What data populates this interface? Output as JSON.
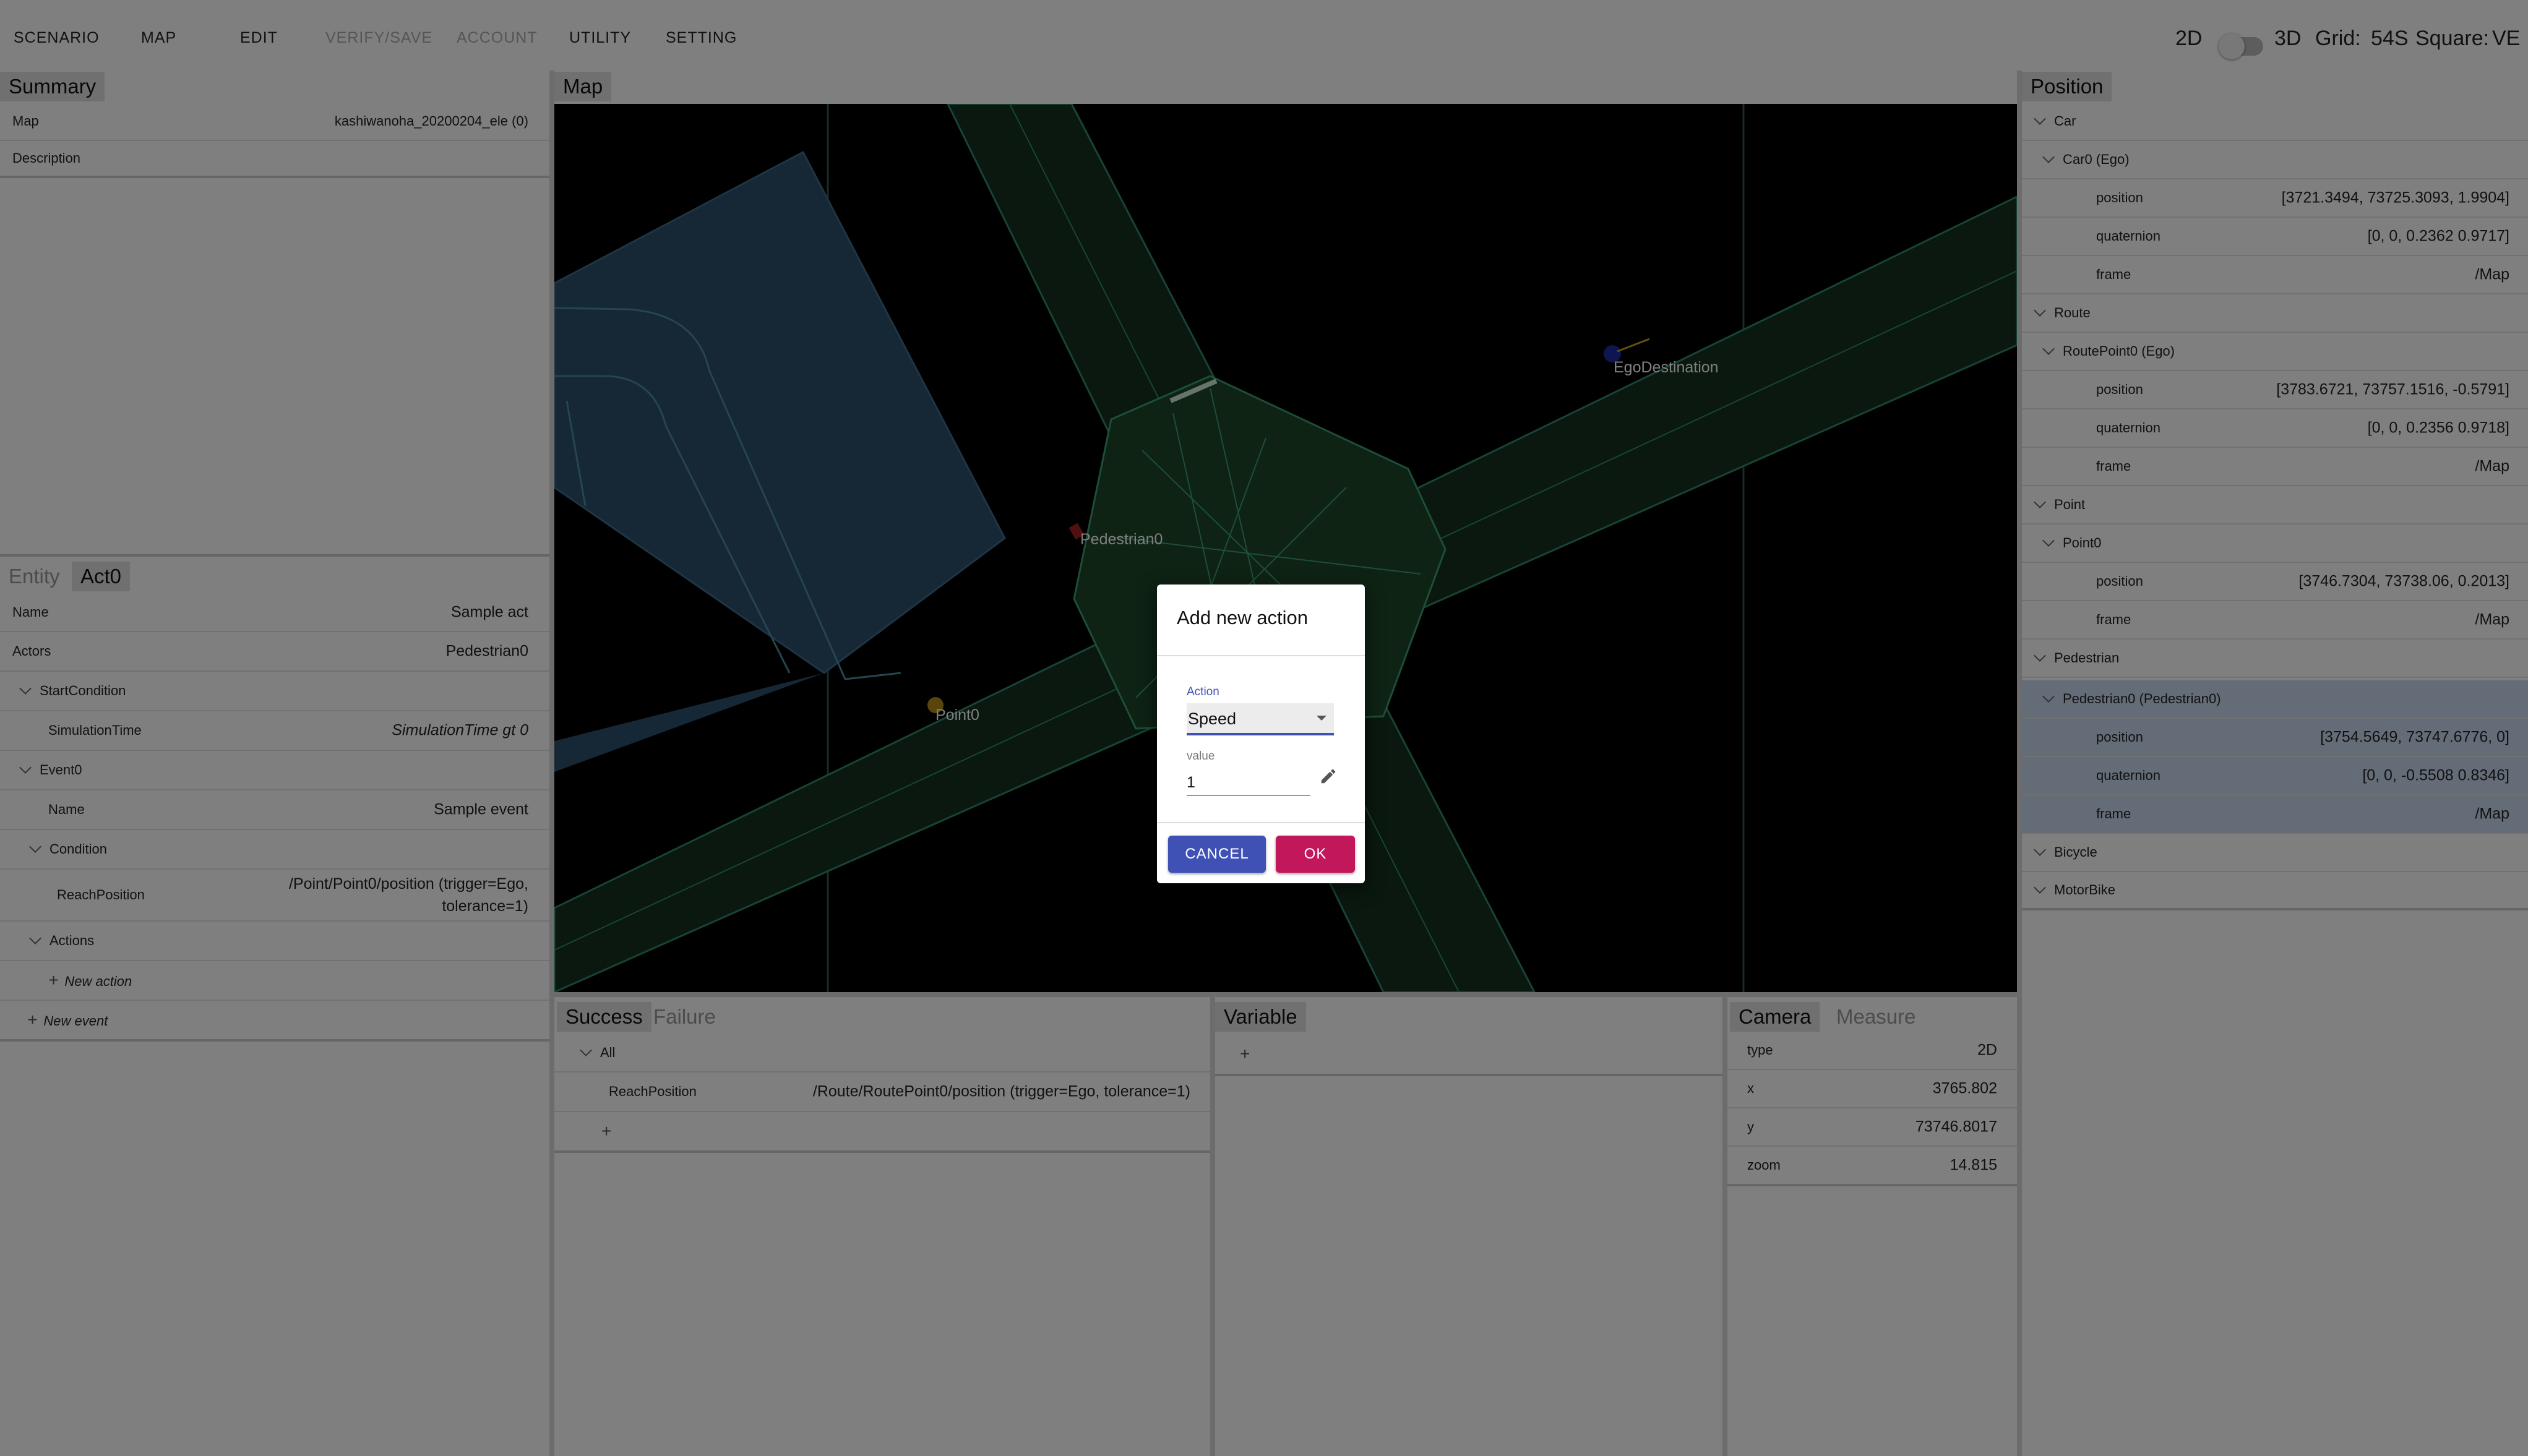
{
  "menu": {
    "items": [
      {
        "label": "SCENARIO",
        "disabled": false
      },
      {
        "label": "MAP",
        "disabled": false
      },
      {
        "label": "EDIT",
        "disabled": false
      },
      {
        "label": "VERIFY/SAVE",
        "disabled": true
      },
      {
        "label": "ACCOUNT",
        "disabled": true
      },
      {
        "label": "UTILITY",
        "disabled": false
      },
      {
        "label": "SETTING",
        "disabled": false
      }
    ],
    "view_2d": "2D",
    "view_3d": "3D",
    "grid_label": "Grid:",
    "grid_value": "54S",
    "square_label": "Square:",
    "square_value": "VE"
  },
  "summary": {
    "tab": "Summary",
    "map_label": "Map",
    "map_value": "kashiwanoha_20200204_ele (0)",
    "description_label": "Description"
  },
  "act_panel": {
    "tabs": [
      "Entity",
      "Act0"
    ],
    "name_label": "Name",
    "name_value": "Sample act",
    "actors_label": "Actors",
    "actors_value": "Pedestrian0",
    "start_condition": "StartCondition",
    "simulation_time_label": "SimulationTime",
    "simulation_time_value": "SimulationTime gt 0",
    "event_label": "Event0",
    "event_name_label": "Name",
    "event_name_value": "Sample event",
    "condition_label": "Condition",
    "reach_position_label": "ReachPosition",
    "reach_position_value_line1": "/Point/Point0/position (trigger=Ego,",
    "reach_position_value_line2": "tolerance=1)",
    "actions_label": "Actions",
    "new_action": "New action",
    "new_event": "New event"
  },
  "map_panel": {
    "tab": "Map",
    "labels": {
      "pedestrian": "Pedestrian0",
      "point": "Point0",
      "ego_destination": "EgoDestination"
    }
  },
  "success_panel": {
    "tabs": [
      "Success",
      "Failure"
    ],
    "all_label": "All",
    "reach_label": "ReachPosition",
    "reach_value": "/Route/RoutePoint0/position (trigger=Ego, tolerance=1)",
    "add": "+"
  },
  "variable_panel": {
    "tab": "Variable",
    "add": "+"
  },
  "camera_panel": {
    "tabs": [
      "Camera",
      "Measure"
    ],
    "rows": [
      {
        "label": "type",
        "value": "2D"
      },
      {
        "label": "x",
        "value": "3765.802"
      },
      {
        "label": "y",
        "value": "73746.8017"
      },
      {
        "label": "zoom",
        "value": "14.815"
      }
    ]
  },
  "position_panel": {
    "tab": "Position",
    "rows": [
      {
        "indent": 0,
        "chevron": true,
        "label": "Car",
        "value": "",
        "selected": false
      },
      {
        "indent": 1,
        "chevron": true,
        "label": "Car0 (Ego)",
        "value": "",
        "selected": false
      },
      {
        "indent": 2,
        "chevron": false,
        "label": "position",
        "value": "[3721.3494, 73725.3093, 1.9904]",
        "selected": false
      },
      {
        "indent": 2,
        "chevron": false,
        "label": "quaternion",
        "value": "[0, 0, 0.2362 0.9717]",
        "selected": false
      },
      {
        "indent": 2,
        "chevron": false,
        "label": "frame",
        "value": "/Map",
        "selected": false
      },
      {
        "indent": 0,
        "chevron": true,
        "label": "Route",
        "value": "",
        "selected": false
      },
      {
        "indent": 1,
        "chevron": true,
        "label": "RoutePoint0 (Ego)",
        "value": "",
        "selected": false
      },
      {
        "indent": 2,
        "chevron": false,
        "label": "position",
        "value": "[3783.6721, 73757.1516, -0.5791]",
        "selected": false
      },
      {
        "indent": 2,
        "chevron": false,
        "label": "quaternion",
        "value": "[0, 0, 0.2356 0.9718]",
        "selected": false
      },
      {
        "indent": 2,
        "chevron": false,
        "label": "frame",
        "value": "/Map",
        "selected": false
      },
      {
        "indent": 0,
        "chevron": true,
        "label": "Point",
        "value": "",
        "selected": false
      },
      {
        "indent": 1,
        "chevron": true,
        "label": "Point0",
        "value": "",
        "selected": false
      },
      {
        "indent": 2,
        "chevron": false,
        "label": "position",
        "value": "[3746.7304, 73738.06, 0.2013]",
        "selected": false
      },
      {
        "indent": 2,
        "chevron": false,
        "label": "frame",
        "value": "/Map",
        "selected": false
      },
      {
        "indent": 0,
        "chevron": true,
        "label": "Pedestrian",
        "value": "",
        "selected": false
      },
      {
        "indent": 1,
        "chevron": true,
        "label": "Pedestrian0 (Pedestrian0)",
        "value": "",
        "selected": true
      },
      {
        "indent": 2,
        "chevron": false,
        "label": "position",
        "value": "[3754.5649, 73747.6776, 0]",
        "selected": true
      },
      {
        "indent": 2,
        "chevron": false,
        "label": "quaternion",
        "value": "[0, 0, -0.5508 0.8346]",
        "selected": true
      },
      {
        "indent": 2,
        "chevron": false,
        "label": "frame",
        "value": "/Map",
        "selected": true
      },
      {
        "indent": 0,
        "chevron": true,
        "label": "Bicycle",
        "value": "",
        "selected": false
      },
      {
        "indent": 0,
        "chevron": true,
        "label": "MotorBike",
        "value": "",
        "selected": false
      }
    ]
  },
  "dialog": {
    "title": "Add new action",
    "action_label": "Action",
    "action_value": "Speed",
    "value_label": "value",
    "value_value": "1",
    "cancel": "CANCEL",
    "ok": "OK"
  }
}
